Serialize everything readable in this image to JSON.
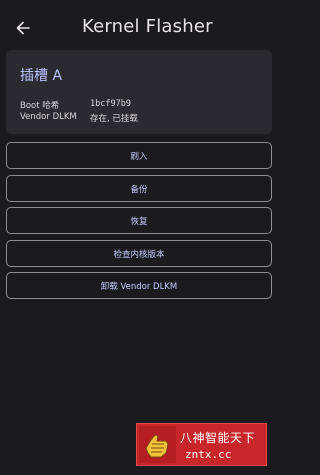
{
  "header": {
    "title": "Kernel Flasher",
    "back_icon": "arrow-left-icon"
  },
  "slot": {
    "title": "插槽 A",
    "rows": [
      {
        "key": "Boot 哈希",
        "value": "1bcf97b9"
      },
      {
        "key": "Vendor DLKM",
        "value": "存在, 已挂载"
      }
    ]
  },
  "actions": [
    {
      "label": "刷入"
    },
    {
      "label": "备份"
    },
    {
      "label": "恢复"
    },
    {
      "label": "检查内核版本"
    },
    {
      "label": "卸载 Vendor DLKM"
    }
  ],
  "watermark": {
    "text": "八神智能天下",
    "url": "zntx.cc"
  },
  "colors": {
    "background": "#1b1b1f",
    "card": "#2b2a30",
    "accent": "#b9c3ff",
    "button_border": "#8e8d95",
    "watermark_red": "#c8262a"
  }
}
